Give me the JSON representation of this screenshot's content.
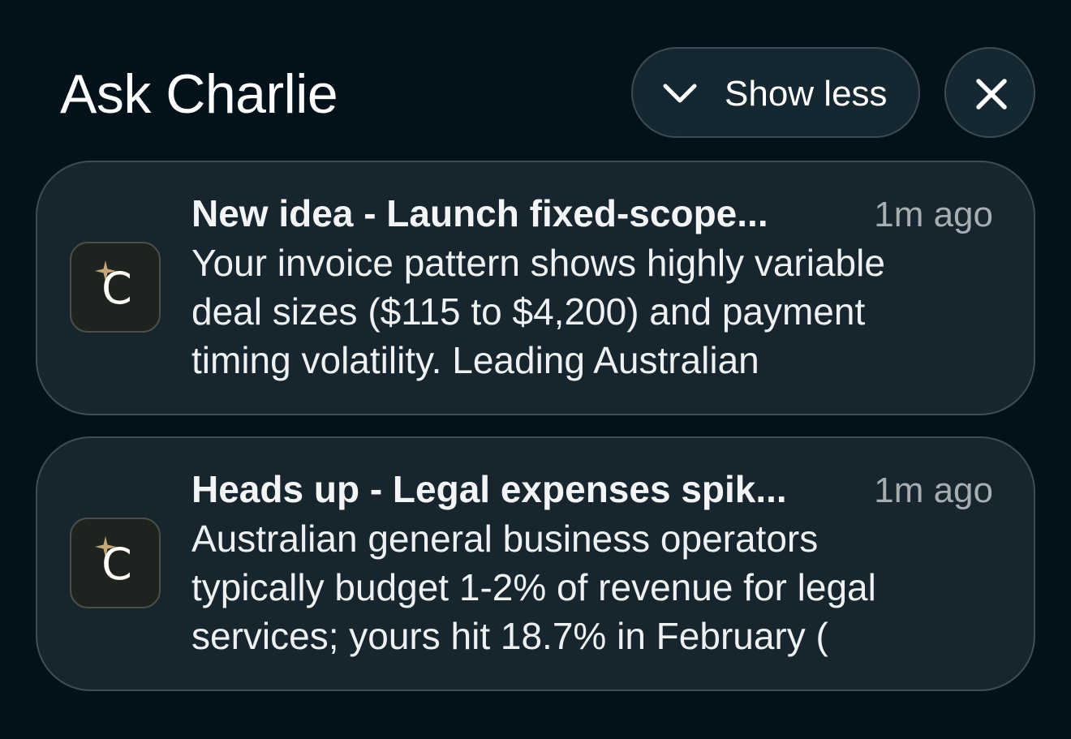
{
  "header": {
    "title": "Ask Charlie",
    "show_less_label": "Show less"
  },
  "icons": {
    "collapse": "chevron-down-icon",
    "close": "close-icon",
    "app": "charlie-app-icon",
    "sparkle": "sparkle-icon"
  },
  "colors": {
    "background": "#03121a",
    "card": "#16252e",
    "button": "#152730",
    "sparkle": "#c7a778",
    "timestamp": "#a6aeb2"
  },
  "notifications": [
    {
      "app_letter": "C",
      "title": "New idea - Launch fixed-scope...",
      "time": "1m ago",
      "body_lines": [
        "Your invoice pattern shows highly variable",
        "deal sizes ($115 to $4,200) and payment",
        "timing volatility. Leading Australian"
      ]
    },
    {
      "app_letter": "C",
      "title": "Heads up - Legal expenses spik...",
      "time": "1m ago",
      "body_lines": [
        "Australian general business operators",
        "typically budget 1-2% of revenue for legal",
        "services; yours hit 18.7% in February ("
      ]
    }
  ]
}
